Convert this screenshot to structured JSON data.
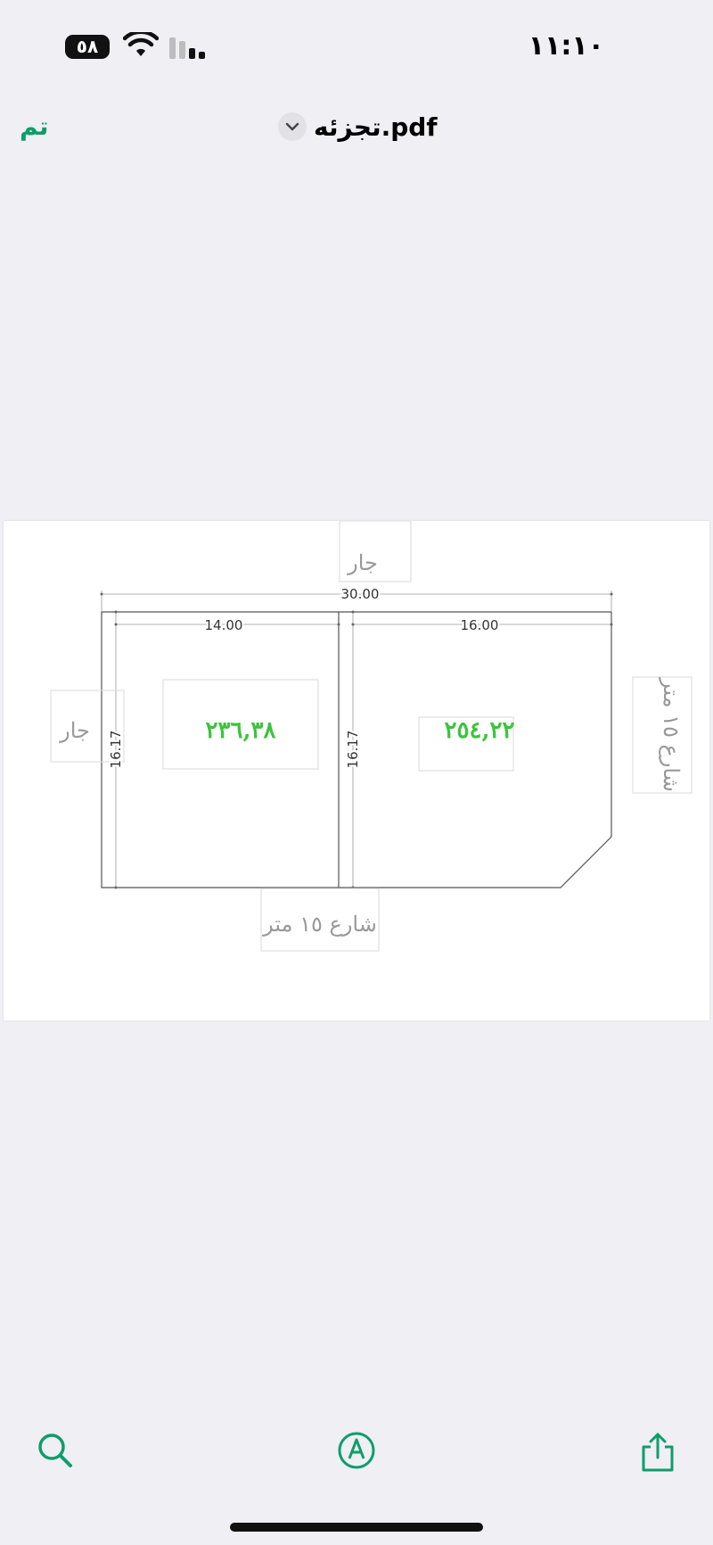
{
  "status_bar": {
    "time": "١١:١٠",
    "battery_level": "٥٨"
  },
  "nav": {
    "done_label": "تم",
    "document_title": "تجزئه.pdf"
  },
  "drawing": {
    "top_neighbor": "جار",
    "left_neighbor": "جار",
    "bottom_street": "شارع ١٥ متر",
    "right_street": "شارع ١٥ متر",
    "total_width": "30.00",
    "left_lot_width": "14.00",
    "right_lot_width": "16.00",
    "left_lot_depth": "16.17",
    "right_lot_depth": "16.17",
    "left_lot_area": "٢٣٦,٣٨",
    "right_lot_area": "٢٥٤,٢٢",
    "line_color": "#555555",
    "area_color": "#3cc43c"
  },
  "toolbar": {
    "search": "search-icon",
    "markup": "markup-pen-icon",
    "share": "share-icon",
    "accent_color": "#0f9d6a"
  }
}
